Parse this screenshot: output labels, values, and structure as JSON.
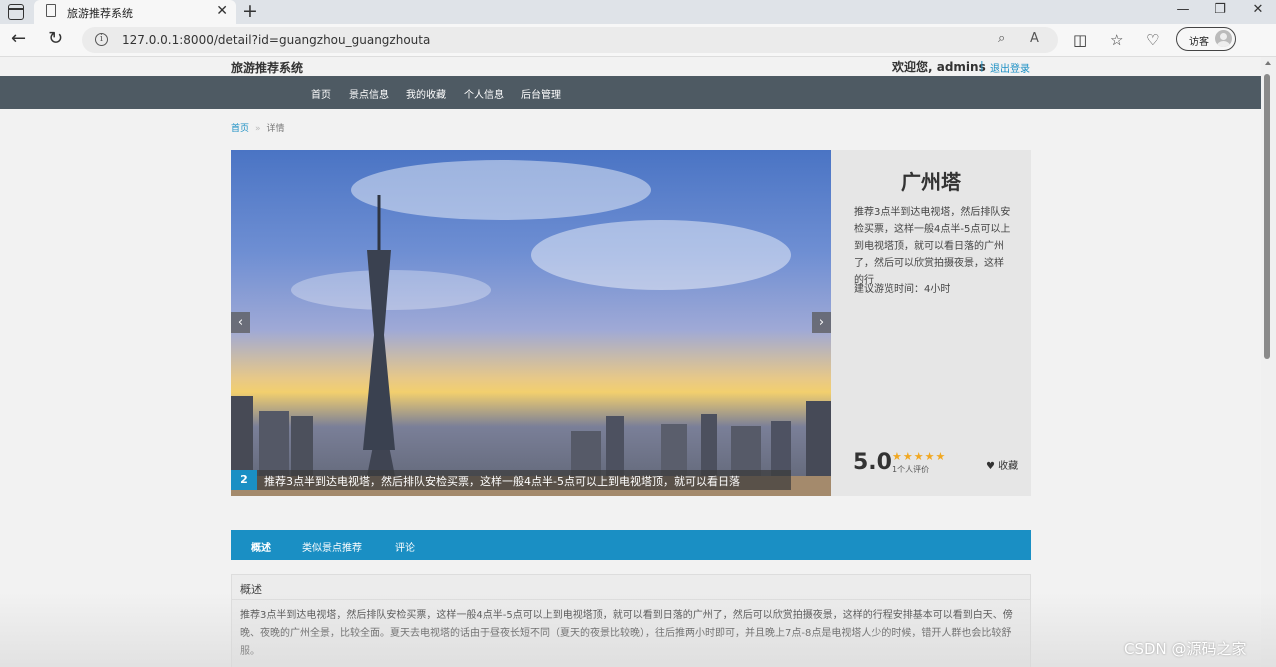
{
  "browser": {
    "tab_title": "旅游推荐系统",
    "url": "127.0.0.1:8000/detail?id=guangzhou_guangzhouta",
    "guest_label": "访客",
    "icons": {
      "sidebar": "tab-sidebar-icon",
      "page": "page-icon",
      "close": "close-icon",
      "new_tab": "plus-icon",
      "back": "arrow-left-icon",
      "reload": "reload-icon",
      "info": "info-icon",
      "zoom": "zoom-icon",
      "read_aloud": "read-aloud-icon",
      "split": "split-screen-icon",
      "favorites": "favorites-icon",
      "extensions": "extensions-icon"
    }
  },
  "site": {
    "name": "旅游推荐系统",
    "welcome": "欢迎您, admins",
    "separator": "|",
    "logout": "退出登录"
  },
  "nav": {
    "items": [
      "首页",
      "景点信息",
      "我的收藏",
      "个人信息",
      "后台管理"
    ]
  },
  "breadcrumb": {
    "home": "首页",
    "sep": "»",
    "current": "详情"
  },
  "carousel": {
    "prev": "‹",
    "next": "›",
    "slide_number": "2",
    "caption": "推荐3点半到达电视塔，然后排队安检买票，这样一般4点半-5点可以上到电视塔顶，就可以看日落"
  },
  "spot": {
    "name": "广州塔",
    "description": "推荐3点半到达电视塔，然后排队安检买票，这样一般4点半-5点可以上到电视塔顶，就可以看日落的广州了，然后可以欣赏拍摄夜景，这样的行",
    "suggested_time": "建议游览时间：4小时",
    "score": "5.0",
    "stars": "★★★★★",
    "star_rating": 5,
    "review_count": "1个人评价",
    "favorite": "♥ 收藏"
  },
  "tabs": [
    "概述",
    "类似景点推荐",
    "评论"
  ],
  "overview": {
    "title": "概述",
    "body": "推荐3点半到达电视塔，然后排队安检买票，这样一般4点半-5点可以上到电视塔顶，就可以看到日落的广州了，然后可以欣赏拍摄夜景，这样的行程安排基本可以看到白天、傍晚、夜晚的广州全景，比较全面。夏天去电视塔的话由于昼夜长短不同（夏天的夜景比较晚），往后推两小时即可，并且晚上7点-8点是电视塔人少的时候，错开人群也会比较舒服。"
  },
  "watermark": "CSDN @源码之家",
  "colors": {
    "accent": "#1a8fc4",
    "navbar": "#4e5a63",
    "star": "#f1a822"
  }
}
